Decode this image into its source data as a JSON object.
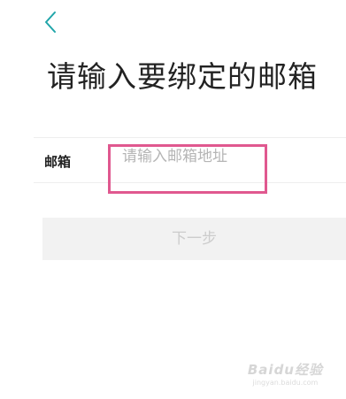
{
  "header": {
    "back_icon": "chevron-left-icon",
    "accent_color": "#1fa5a9"
  },
  "title": "请输入要绑定的邮箱",
  "form": {
    "email_label": "邮箱",
    "email_value": "",
    "email_placeholder": "请输入邮箱地址",
    "highlight_color": "#e0588f"
  },
  "next_button": "下一步",
  "watermark": {
    "logo_text": "Baidu经验",
    "url": "jingyan.baidu.com"
  }
}
